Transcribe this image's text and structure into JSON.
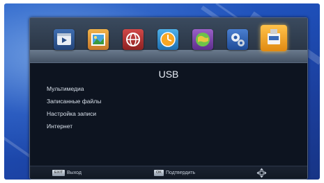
{
  "header": {
    "title": "USB"
  },
  "icons": [
    {
      "name": "video-icon"
    },
    {
      "name": "picture-icon"
    },
    {
      "name": "globe-network-icon"
    },
    {
      "name": "clock-icon"
    },
    {
      "name": "earth-icon"
    },
    {
      "name": "settings-gears-icon"
    },
    {
      "name": "usb-icon",
      "selected": true
    }
  ],
  "menu": {
    "items": [
      {
        "label": "Мультимедиа"
      },
      {
        "label": "Записанные файлы"
      },
      {
        "label": "Настройка записи"
      },
      {
        "label": "Интернет"
      }
    ]
  },
  "footer": {
    "exit_key": "EXIT",
    "exit_label": "Выход",
    "ok_key": "OK",
    "ok_label": "Подтвердить",
    "nav_icon": "navigation-arrows-icon"
  },
  "colors": {
    "background": "#1e4fb8",
    "panel": "#0d1420",
    "selected_icon": "#f0a020"
  }
}
